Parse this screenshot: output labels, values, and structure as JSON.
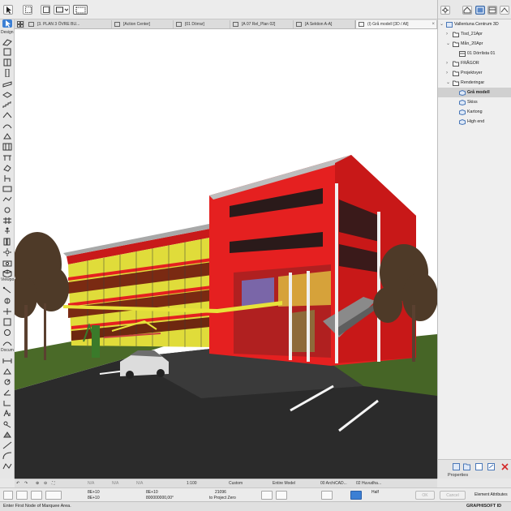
{
  "toolbox": {
    "groups": [
      "Design",
      "Viewpo",
      "Docum"
    ]
  },
  "tabs": [
    {
      "label": "[3. PLAN 3 ÖVRE BU..."
    },
    {
      "label": "[Action Center]"
    },
    {
      "label": "[01 Dörrar]"
    },
    {
      "label": "[A 07 Rel_Plan 02]"
    },
    {
      "label": "[A Sektion A-A]"
    },
    {
      "label": "(I) Grå modell [3D / All]"
    }
  ],
  "navigator": {
    "root": "Vallentuna Centrum 3D",
    "items": [
      {
        "label": "Tisd_21Apr"
      },
      {
        "label": "Mån_20Apr"
      },
      {
        "label": "01 Dörrlista 01"
      },
      {
        "label": "FRÅGOR"
      },
      {
        "label": "Projektvyer"
      },
      {
        "label": "Renderingar"
      },
      {
        "label": "Grå modell"
      },
      {
        "label": "Skiss"
      },
      {
        "label": "Kartong"
      },
      {
        "label": "High end"
      }
    ],
    "properties_label": "Properties"
  },
  "status": {
    "na1": "N/A",
    "na2": "N/A",
    "na3": "N/A",
    "scale": "1:100",
    "custom": "Custom",
    "entire": "Entire Model",
    "archicad": "00 ArchiCAD...",
    "huvud": "02 Huvudha..."
  },
  "infobox": {
    "a1": "8E+10",
    "a2": "8E+10",
    "a3": "8E+10",
    "a4": "800000000,00°",
    "b1": "21096",
    "b2": "to Project Zero",
    "half": "Half",
    "ok": "OK",
    "cancel": "Cancel",
    "element": "Element Attributes"
  },
  "message": "Enter First Node of Marquee Area.",
  "brand": "GRAPHISOFT ID",
  "colors": {
    "accent": "#3b7fd4",
    "building_red": "#e52020",
    "building_yellow": "#e8e23a",
    "ground": "#2a2a2a",
    "grass": "#4f6f2a"
  }
}
